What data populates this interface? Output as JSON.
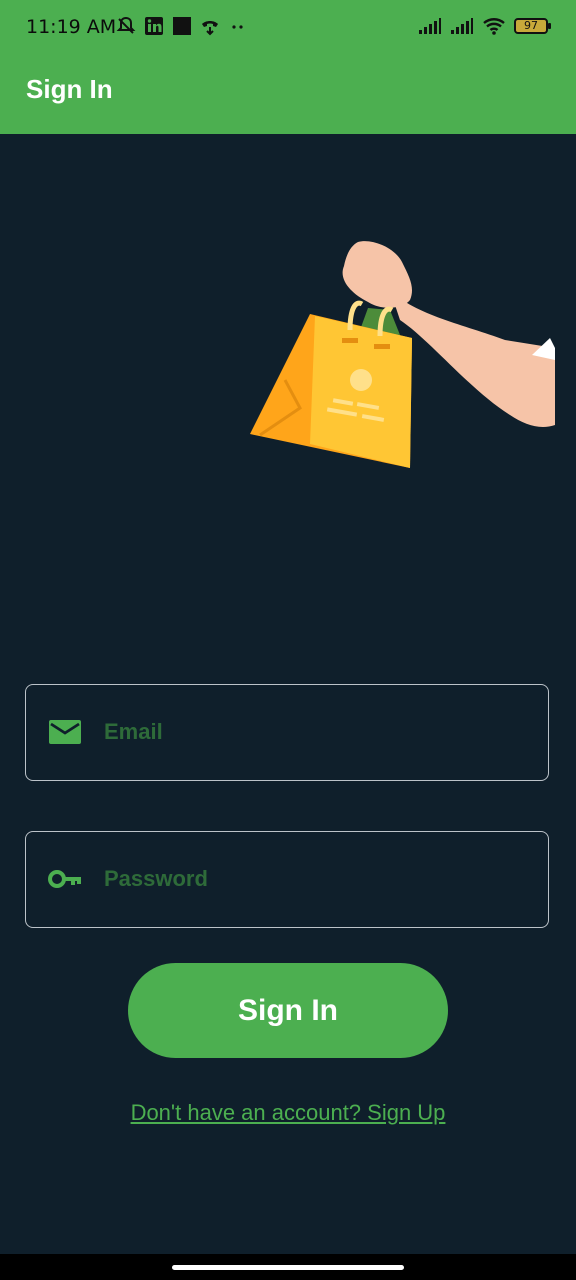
{
  "status_bar": {
    "time": "11:19 AM",
    "battery": "97",
    "left_icons": [
      "bell-off-icon",
      "linkedin-icon",
      "square-icon",
      "call-icon",
      "more-dots-icon"
    ],
    "right_icons": [
      "signal-icon",
      "signal-icon",
      "wifi-icon",
      "battery-icon"
    ]
  },
  "app_bar": {
    "title": "Sign In"
  },
  "form": {
    "email": {
      "placeholder": "Email",
      "icon": "mail-icon"
    },
    "password": {
      "placeholder": "Password",
      "icon": "key-icon"
    },
    "submit_label": "Sign In",
    "signup_link": "Don't have an account? Sign Up"
  },
  "colors": {
    "primary": "#4caf50",
    "background": "#0f1f2b",
    "placeholder": "#2e6b39",
    "field_border": "#bcc3c9"
  }
}
